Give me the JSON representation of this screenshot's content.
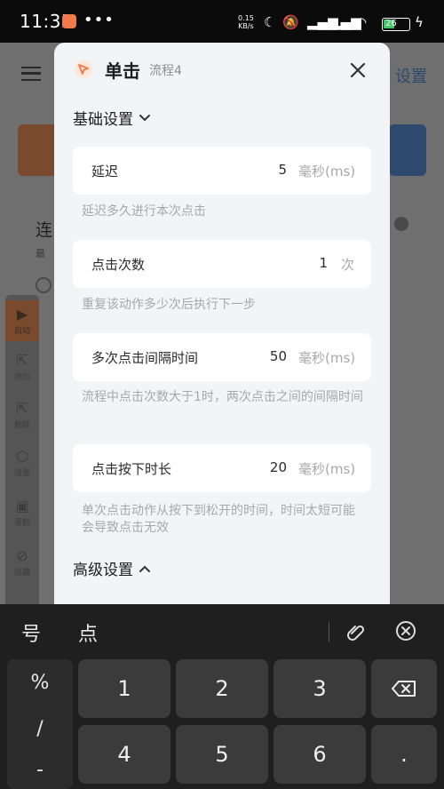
{
  "status_bar": {
    "time": "11:35",
    "dots": "•••",
    "net_speed_top": "0.15",
    "net_speed_bottom": "KB/s",
    "battery": "26"
  },
  "background": {
    "settings_label": "设置",
    "title": "连",
    "subtitle": "最",
    "sidebar": [
      "启动",
      "添加",
      "删除",
      "设置",
      "录制",
      "隐藏"
    ]
  },
  "modal": {
    "title": "单击",
    "subtitle": "流程4",
    "basic_section": "基础设置",
    "advanced_section": "高级设置",
    "fields": [
      {
        "label": "延迟",
        "value": "5",
        "unit": "毫秒(ms)",
        "help": "延迟多久进行本次点击"
      },
      {
        "label": "点击次数",
        "value": "1",
        "unit": "次",
        "help": "重复该动作多少次后执行下一步"
      },
      {
        "label": "多次点击间隔时间",
        "value": "50",
        "unit": "毫秒(ms)",
        "help": "流程中点击次数大于1时，两次点击之间的间隔时间"
      },
      {
        "label": "点击按下时长",
        "value": "20",
        "unit": "毫秒(ms)",
        "help": "单次点击动作从按下到松开的时间，时间太短可能会导致点击无效"
      }
    ]
  },
  "keyboard": {
    "candidates": [
      "号",
      "点"
    ],
    "symbols": [
      "%",
      "/",
      "-"
    ],
    "keys": [
      "1",
      "2",
      "3",
      "4",
      "5",
      "6",
      "."
    ]
  },
  "colors": {
    "accent": "#f07a4a",
    "modal_bg": "#f3f4f6",
    "card_bg": "#ffffff",
    "help_text": "#a8a8a8"
  }
}
